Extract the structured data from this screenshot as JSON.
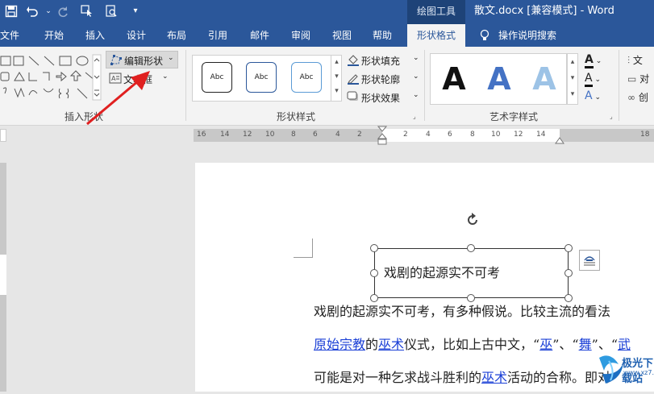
{
  "title_bar": {
    "context_group": "绘图工具",
    "document_title": "散文.docx [兼容模式]  -  Word"
  },
  "menu_tabs": [
    "文件",
    "开始",
    "插入",
    "设计",
    "布局",
    "引用",
    "邮件",
    "审阅",
    "视图",
    "帮助"
  ],
  "active_tab": "形状格式",
  "tell_me": "操作说明搜索",
  "ribbon": {
    "insert_shapes": {
      "edit_shape": "编辑形状",
      "text_box": "文本框",
      "label": "插入形状"
    },
    "shape_styles": {
      "samples": [
        "Abc",
        "Abc",
        "Abc"
      ],
      "fill": "形状填充",
      "outline": "形状轮廓",
      "effect": "形状效果",
      "label": "形状样式"
    },
    "wordart": {
      "letters": [
        "A",
        "A",
        "A"
      ],
      "label": "艺术字样式"
    },
    "text_group": {
      "items": [
        "文",
        "对",
        "创"
      ]
    }
  },
  "ruler": {
    "left_numbers": [
      "16",
      "14",
      "12",
      "10",
      "8",
      "6",
      "4",
      "2"
    ],
    "right_numbers": [
      "2",
      "4",
      "6",
      "8",
      "10",
      "12",
      "14"
    ],
    "far_right": "18"
  },
  "document": {
    "textbox_text": "戏剧的起源实不可考",
    "line1": "戏剧的起源实不可考，有多种假说。比较主流的看法",
    "line2": {
      "a": "原始宗教",
      "b": "的",
      "c": "巫术",
      "d": "仪式，比如上古中文，“",
      "e": "巫",
      "f": "”、“",
      "g": "舞",
      "h": "”、“",
      "i": "武"
    },
    "line3": {
      "a": "可能是对一种乞求战斗胜利的",
      "b": "巫术",
      "c": "活动的合称。即对"
    }
  },
  "watermark": {
    "name": "极光下载站",
    "url": "www.xz7.com"
  },
  "colors": {
    "title_blue": "#2b579a",
    "ribbon_bg": "#f3f3f3",
    "arrow_red": "#e02020",
    "link_blue": "#1a3fd6"
  }
}
